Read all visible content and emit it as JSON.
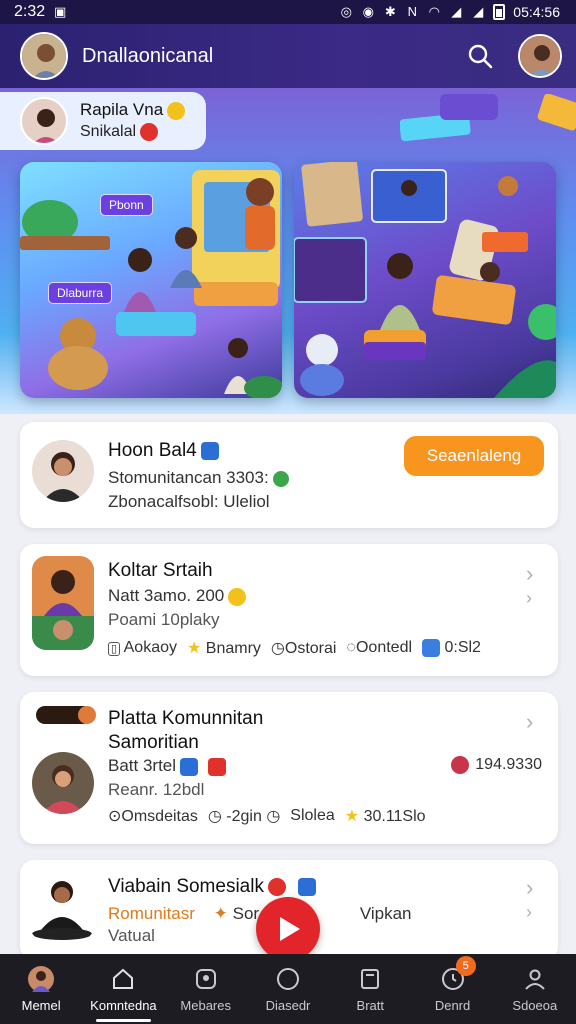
{
  "status_bar": {
    "time": "2:32",
    "clock": "05:4:56"
  },
  "app_bar": {
    "title": "Dnallaonicanal"
  },
  "hero": {
    "chip": {
      "name": "Rapila Vna",
      "subtitle": "Snikalal"
    },
    "left_tags": [
      "Pbonn",
      "Dlaburra"
    ]
  },
  "cards": [
    {
      "name": "Hoon Bal4",
      "line1": "Stomunitancan 3303:",
      "line2": "Zbonacalfsobl: Uleliol",
      "button": "Seaenlaleng"
    },
    {
      "name": "Koltar Srtaih",
      "line1": "Natt 3amo. 200",
      "line2": "Poami 10plaky",
      "meta": [
        "Aokaoy",
        "Bnamry",
        "Ostorai",
        "Oontedl",
        "0:Sl2"
      ]
    },
    {
      "name_line1": "Platta Komunnitan",
      "name_line2": "Samoritian",
      "line1": "Batt 3rtel",
      "line2": "Reanr. 12bdl",
      "count": "194.9330",
      "meta": [
        "Omsdeitas",
        "-2gin",
        "Slolea",
        "30.11Slo"
      ]
    },
    {
      "name": "Viabain Somesialk",
      "line1a": "Romunitasr",
      "line1b": "Sor",
      "line1c": "Vipkan",
      "line2": "Vatual"
    }
  ],
  "bottom_nav": [
    {
      "label": "Memel",
      "icon": "avatar-icon",
      "active": true
    },
    {
      "label": "Komntedna",
      "icon": "home-icon",
      "active": false
    },
    {
      "label": "Mebares",
      "icon": "members-icon",
      "active": false
    },
    {
      "label": "Diasedr",
      "icon": "circle-icon",
      "active": false
    },
    {
      "label": "Bratt",
      "icon": "document-icon",
      "active": false
    },
    {
      "label": "Denrd",
      "icon": "notifications-icon",
      "active": false,
      "badge": "5"
    },
    {
      "label": "Sdoeoa",
      "icon": "profile-icon",
      "active": false
    }
  ],
  "colors": {
    "accent_orange": "#f7951e",
    "fab_red": "#e2252a",
    "app_bar": "#2b2170",
    "nav_bg": "#1c1c22"
  }
}
